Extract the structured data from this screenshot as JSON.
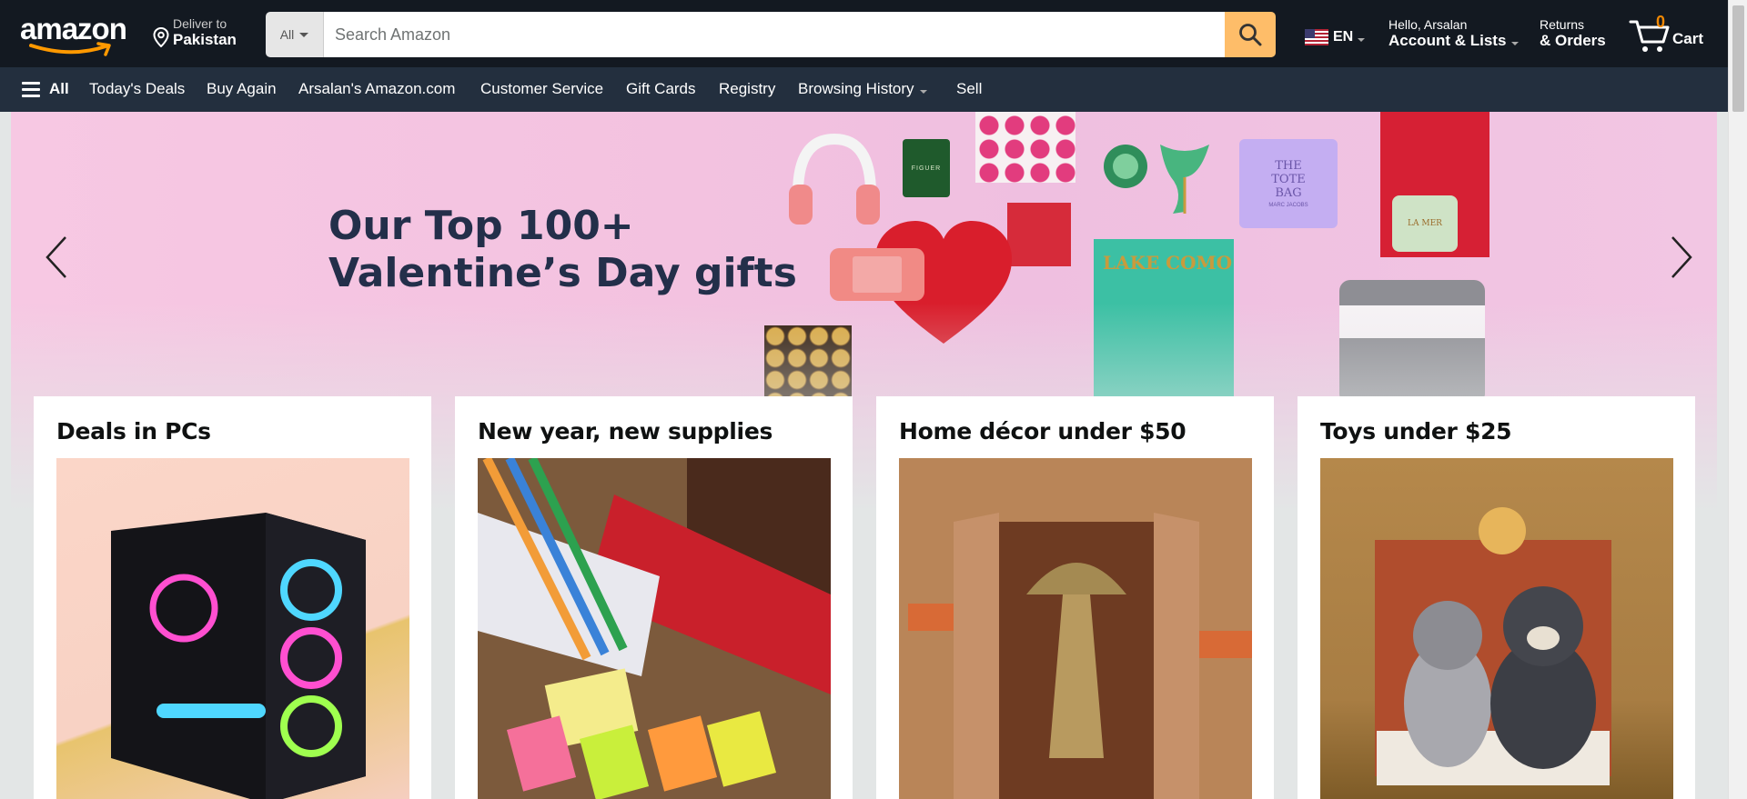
{
  "header": {
    "logo_text": "amazon",
    "deliver_line1": "Deliver to",
    "deliver_line2": "Pakistan",
    "search_category": "All",
    "search_placeholder": "Search Amazon",
    "language": "EN",
    "account_line1": "Hello, Arsalan",
    "account_line2": "Account & Lists",
    "returns_line1": "Returns",
    "returns_line2": "& Orders",
    "cart_count": "0",
    "cart_label": "Cart"
  },
  "subnav": {
    "all_label": "All",
    "items": [
      "Today's Deals",
      "Buy Again",
      "Arsalan's Amazon.com",
      "Customer Service",
      "Gift Cards",
      "Registry",
      "Browsing History",
      "Sell"
    ]
  },
  "hero": {
    "title_line1": "Our Top 100+",
    "title_line2": "Valentine’s Day gifts",
    "gift_labels": {
      "candle": "FIGUER",
      "tote": "THE TOTE BAG",
      "tote_brand": "MARC JACOBS",
      "book": "LAKE COMO",
      "jar": "LA MER"
    }
  },
  "cards": [
    {
      "title": "Deals in PCs"
    },
    {
      "title": "New year, new supplies"
    },
    {
      "title": "Home décor under $50"
    },
    {
      "title": "Toys under $25"
    }
  ],
  "colors": {
    "nav_bg": "#131921",
    "subnav_bg": "#232f3e",
    "search_button": "#febd69",
    "cart_count": "#f08804",
    "hero_bg": "#f5c4e1",
    "hero_title": "#232f4a"
  }
}
